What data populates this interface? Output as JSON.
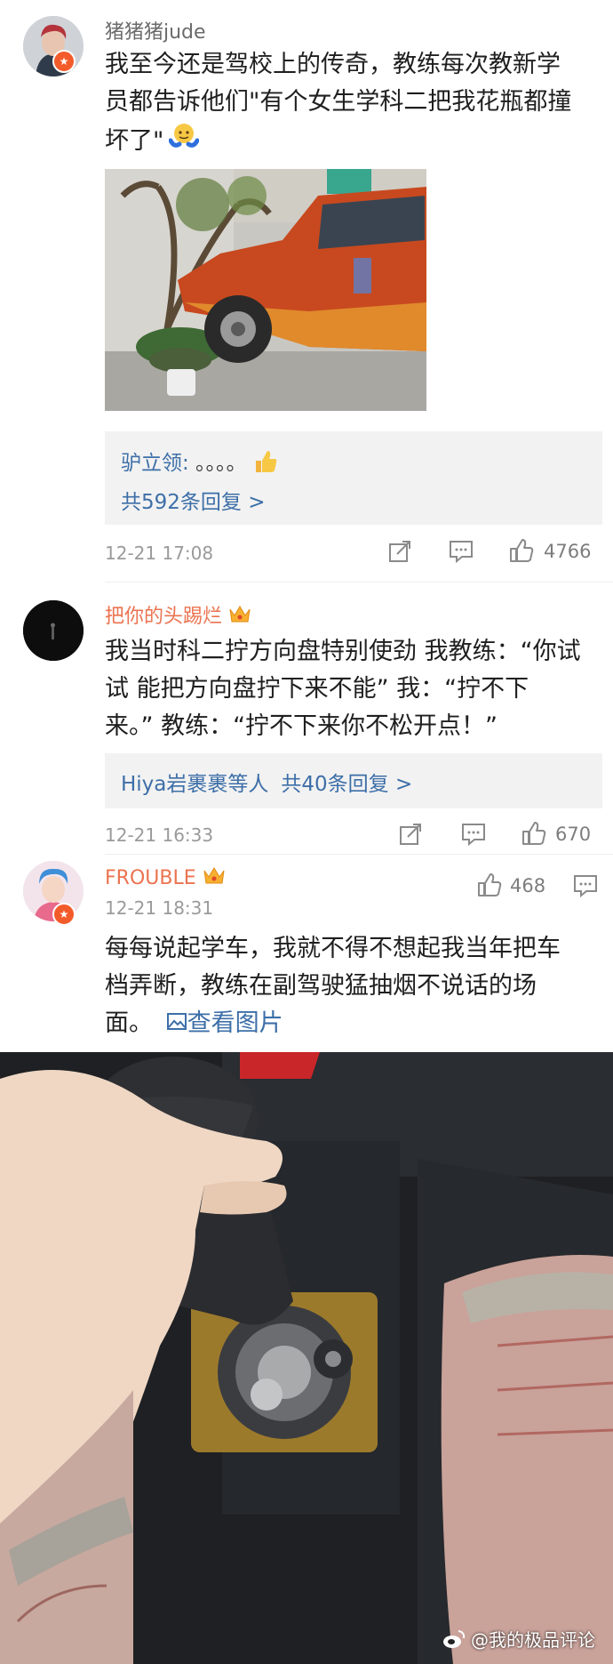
{
  "comments": [
    {
      "username": "猪猪猪jude",
      "text_lines": [
        "我至今还是驾校上的传奇，教练每次教新学",
        "员都告诉他们\"有个女生学科二把我花瓶都撞",
        "坏了\""
      ],
      "reply_preview_name": "驴立领:",
      "reply_preview_text": " 。。。。",
      "reply_count_label": "共592条回复 >",
      "timestamp": "12-21 17:08",
      "likes": "4766"
    },
    {
      "username": "把你的头踢烂",
      "text_lines": [
        "我当时科二拧方向盘特别使劲 我教练：“你试",
        "试 能把方向盘拧下来不能” 我：“拧不下",
        "来。” 教练：“拧不下来你不松开点！”"
      ],
      "reply_preview_name": "Hiya岩裹裹等人",
      "reply_count_label": "共40条回复 >",
      "timestamp": "12-21 16:33",
      "likes": "670"
    },
    {
      "username": "FROUBLE",
      "timestamp": "12-21 18:31",
      "likes": "468",
      "text_lines": [
        "每每说起学车，我就不得不想起我当年把车",
        "档弄断，教练在副驾驶猛抽烟不说话的场"
      ],
      "text_last": "面。",
      "view_image_label": "查看图片"
    }
  ],
  "watermark": "@我的极品评论",
  "colors": {
    "username_default": "#6b6b6b",
    "username_vip": "#eb7350",
    "link": "#3d6fa8",
    "meta": "#9a9a9a",
    "verified_badge": "#f45b2a"
  },
  "icons": [
    "share-icon",
    "comment-icon",
    "thumbs-up-icon",
    "view-image-icon",
    "weibo-logo-icon",
    "crown-icon",
    "verified-badge-icon"
  ]
}
